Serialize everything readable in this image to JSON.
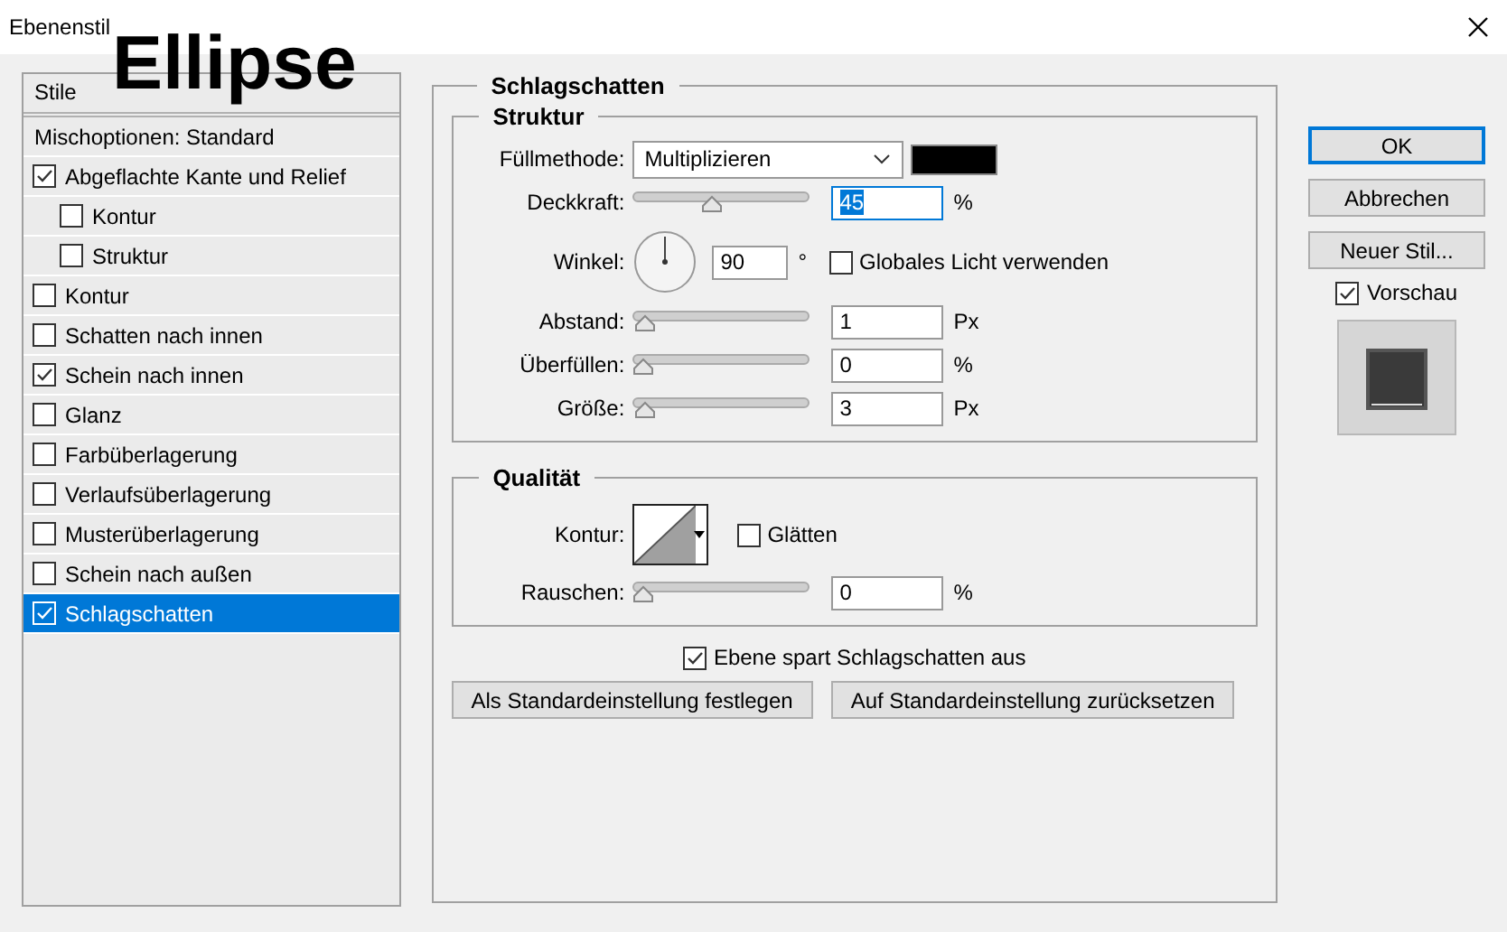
{
  "window": {
    "title": "Ebenenstil"
  },
  "overlay_caption": "Ellipse",
  "styles_panel": {
    "header": "Stile",
    "blend_options": "Mischoptionen: Standard",
    "items": [
      {
        "label": "Abgeflachte Kante und Relief",
        "checked": true,
        "selected": false,
        "children": [
          {
            "label": "Kontur",
            "checked": false,
            "selected": false
          },
          {
            "label": "Struktur",
            "checked": false,
            "selected": false
          }
        ]
      },
      {
        "label": "Kontur",
        "checked": false,
        "selected": false
      },
      {
        "label": "Schatten nach innen",
        "checked": false,
        "selected": false
      },
      {
        "label": "Schein nach innen",
        "checked": true,
        "selected": false
      },
      {
        "label": "Glanz",
        "checked": false,
        "selected": false
      },
      {
        "label": "Farbüberlagerung",
        "checked": false,
        "selected": false
      },
      {
        "label": "Verlaufsüberlagerung",
        "checked": false,
        "selected": false
      },
      {
        "label": "Musterüberlagerung",
        "checked": false,
        "selected": false
      },
      {
        "label": "Schein nach außen",
        "checked": false,
        "selected": false
      },
      {
        "label": "Schlagschatten",
        "checked": true,
        "selected": true
      }
    ]
  },
  "drop_shadow": {
    "title": "Schlagschatten",
    "structure": {
      "title": "Struktur",
      "rows": [
        {
          "kind": "select",
          "label": "Füllmethode:",
          "value": "Multiplizieren"
        },
        {
          "kind": "slider",
          "label": "Deckkraft:",
          "level": 0.45,
          "value": "45",
          "unit": "%",
          "value_selected": true
        },
        {
          "kind": "angle",
          "label": "Winkel:",
          "value": "90",
          "unit": "°",
          "checkbox": {
            "label": "Globales Licht verwenden",
            "checked": false
          }
        },
        {
          "kind": "slider",
          "label": "Abstand:",
          "level": 0.01,
          "value": "1",
          "unit": "Px",
          "value_selected": false
        },
        {
          "kind": "slider",
          "label": "Überfüllen:",
          "level": 0,
          "value": "0",
          "unit": "%",
          "value_selected": false
        },
        {
          "kind": "slider",
          "label": "Größe:",
          "level": 0.02,
          "value": "3",
          "unit": "Px",
          "value_selected": false
        }
      ]
    },
    "quality": {
      "title": "Qualität",
      "rows": [
        {
          "kind": "contour",
          "label": "Kontur:",
          "checkbox": {
            "label": "Glätten",
            "checked": false
          }
        },
        {
          "kind": "slider",
          "label": "Rauschen:",
          "level": 0,
          "value": "0",
          "unit": "%",
          "value_selected": false
        }
      ]
    },
    "knockout": {
      "label": "Ebene spart Schlagschatten aus",
      "checked": true
    },
    "buttons": [
      "Als Standardeinstellung festlegen",
      "Auf Standardeinstellung zurücksetzen"
    ]
  },
  "actions": [
    {
      "label": "OK",
      "default": true
    },
    {
      "label": "Abbrechen",
      "default": false
    },
    {
      "label": "Neuer Stil...",
      "default": false
    }
  ],
  "preview": {
    "label": "Vorschau",
    "checked": true
  }
}
